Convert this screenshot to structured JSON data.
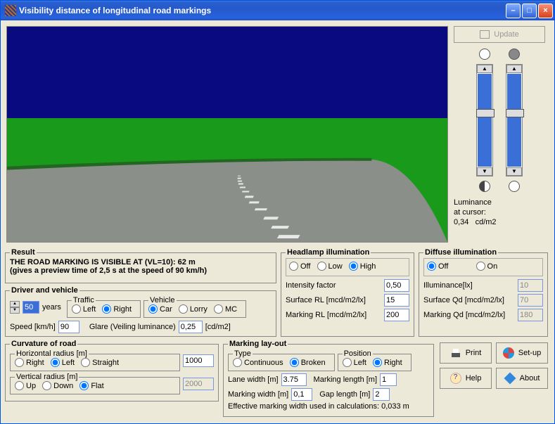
{
  "window": {
    "title": "Visibility distance of longitudinal road markings"
  },
  "side": {
    "update_label": "Update",
    "luminance_label1": "Luminance",
    "luminance_label2": "at cursor:",
    "luminance_value": "0,34",
    "luminance_unit": "cd/m2"
  },
  "result": {
    "legend": "Result",
    "line1": "THE ROAD MARKING IS VISIBLE AT (VL=10):  62  m",
    "line2": "(gives a preview time of 2,5 s at the speed of 90  km/h)"
  },
  "driver": {
    "legend": "Driver and vehicle",
    "age_value": "50",
    "age_unit": "years",
    "traffic_legend": "Traffic",
    "traffic_left": "Left",
    "traffic_right": "Right",
    "vehicle_legend": "Vehicle",
    "vehicle_car": "Car",
    "vehicle_lorry": "Lorry",
    "vehicle_mc": "MC",
    "speed_label": "Speed [km/h]",
    "speed_value": "90",
    "glare_label": "Glare (Veiling luminance)",
    "glare_value": "0,25",
    "glare_unit": "[cd/m2]"
  },
  "headlamp": {
    "legend": "Headlamp illumination",
    "off": "Off",
    "low": "Low",
    "high": "High",
    "intensity_label": "Intensity factor",
    "intensity_value": "0,50",
    "surface_label": "Surface RL [mcd/m2/lx]",
    "surface_value": "15",
    "marking_label": "Marking RL [mcd/m2/lx]",
    "marking_value": "200"
  },
  "diffuse": {
    "legend": "Diffuse illumination",
    "off": "Off",
    "on": "On",
    "illum_label": "Illuminance[lx]",
    "illum_value": "10",
    "surface_label": "Surface Qd [mcd/m2/lx]",
    "surface_value": "70",
    "marking_label": "Marking Qd [mcd/m2/lx]",
    "marking_value": "180"
  },
  "curvature": {
    "legend": "Curvature of road",
    "h_legend": "Horizontal radius [m]",
    "h_right": "Right",
    "h_left": "Left",
    "h_straight": "Straight",
    "h_value": "1000",
    "v_legend": "Vertical radius [m]",
    "v_up": "Up",
    "v_down": "Down",
    "v_flat": "Flat",
    "v_value": "2000"
  },
  "layout": {
    "legend": "Marking lay-out",
    "type_legend": "Type",
    "type_cont": "Continuous",
    "type_broken": "Broken",
    "pos_legend": "Position",
    "pos_left": "Left",
    "pos_right": "Right",
    "lane_label": "Lane width [m]",
    "lane_value": "3.75",
    "mlen_label": "Marking length [m]",
    "mlen_value": "1",
    "mwid_label": "Marking width [m]",
    "mwid_value": "0,1",
    "gap_label": "Gap length [m]",
    "gap_value": "2",
    "eff_label": "Effective marking width used in calculations: 0,033 m"
  },
  "buttons": {
    "print": "Print",
    "setup": "Set-up",
    "help": "Help",
    "about": "About"
  }
}
